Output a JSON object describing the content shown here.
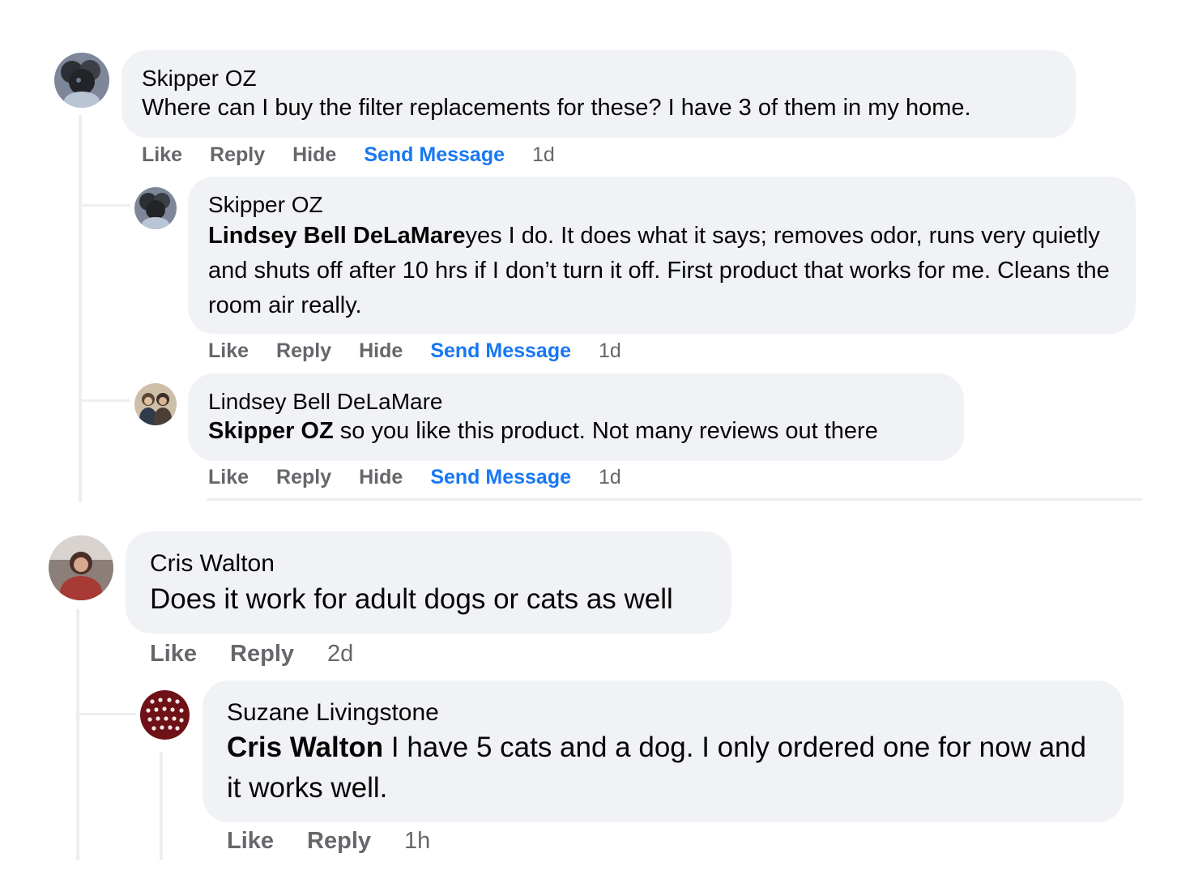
{
  "colors": {
    "bubble": "#f0f2f5",
    "link_blue": "#1877f2",
    "meta_gray": "#65676b",
    "thread_line": "#eceef1"
  },
  "thread1": {
    "comment": {
      "author": "Skipper OZ",
      "text": "Where can I buy the filter replacements for these? I have 3 of them in my home.",
      "actions": {
        "like": "Like",
        "reply": "Reply",
        "hide": "Hide",
        "send": "Send Message",
        "time": "1d"
      }
    },
    "replies": [
      {
        "author": "Skipper OZ",
        "mention": "Lindsey Bell DeLaMare",
        "text": "yes I do. It does what it says; removes odor, runs very quietly and shuts off after 10 hrs if I don’t turn it off. First product that works for me. Cleans the room air really.",
        "actions": {
          "like": "Like",
          "reply": "Reply",
          "hide": "Hide",
          "send": "Send Message",
          "time": "1d"
        }
      },
      {
        "author": "Lindsey Bell DeLaMare",
        "mention": "Skipper OZ",
        "text": " so you like this product. Not many reviews out there",
        "actions": {
          "like": "Like",
          "reply": "Reply",
          "hide": "Hide",
          "send": "Send Message",
          "time": "1d"
        }
      }
    ]
  },
  "thread2": {
    "comment": {
      "author": "Cris Walton",
      "text": "Does it work for adult dogs or cats as well",
      "actions": {
        "like": "Like",
        "reply": "Reply",
        "time": "2d"
      }
    },
    "replies": [
      {
        "author": "Suzane Livingstone",
        "mention": "Cris Walton",
        "text": " I have 5 cats and a dog. I only ordered one for now and it works well.",
        "actions": {
          "like": "Like",
          "reply": "Reply",
          "time": "1h"
        }
      }
    ]
  }
}
